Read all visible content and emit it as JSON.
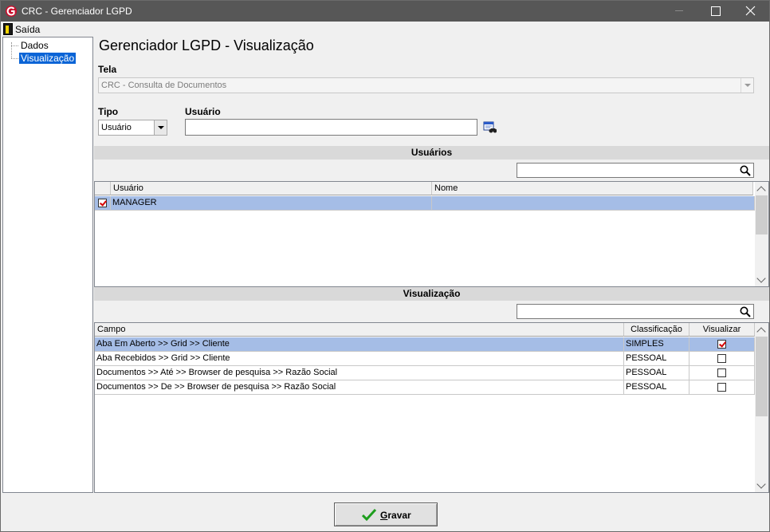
{
  "window": {
    "title": "CRC - Gerenciador LGPD"
  },
  "menu": {
    "exit_label": "Saída"
  },
  "tree": {
    "items": [
      {
        "label": "Dados"
      },
      {
        "label": "Visualização"
      }
    ]
  },
  "page": {
    "title": "Gerenciador LGPD - Visualização",
    "tela_label": "Tela",
    "tela_value": "CRC - Consulta de Documentos",
    "tipo_label": "Tipo",
    "tipo_value": "Usuário",
    "usuario_label": "Usuário",
    "usuario_value": ""
  },
  "usuarios_section": {
    "title": "Usuários",
    "search_value": "",
    "columns": [
      "Usuário",
      "Nome"
    ],
    "rows": [
      {
        "checked": true,
        "usuario": "MANAGER",
        "nome": ""
      }
    ]
  },
  "visualizacao_section": {
    "title": "Visualização",
    "search_value": "",
    "columns": [
      "Campo",
      "Classificação",
      "Visualizar"
    ],
    "rows": [
      {
        "campo": "Aba Em Aberto >> Grid >>  Cliente",
        "classificacao": "SIMPLES",
        "visualizar": true
      },
      {
        "campo": "Aba Recebidos >> Grid >> Cliente",
        "classificacao": "PESSOAL",
        "visualizar": false
      },
      {
        "campo": "Documentos >> Até >> Browser de pesquisa >> Razão Social",
        "classificacao": "PESSOAL",
        "visualizar": false
      },
      {
        "campo": "Documentos >> De >> Browser de pesquisa >> Razão Social",
        "classificacao": "PESSOAL",
        "visualizar": false
      }
    ]
  },
  "actions": {
    "save_label": "Gravar"
  },
  "colors": {
    "titlebar": "#575757",
    "selection": "#a5bde6",
    "tree_selection": "#0a64d6",
    "check_mark": "#d40000",
    "save_check": "#1e9e1e"
  },
  "icons": {
    "app": "crc-logo-icon",
    "exit": "exit-door-icon",
    "lookup": "binoculars-icon",
    "search": "search-icon",
    "save": "checkmark-icon"
  }
}
